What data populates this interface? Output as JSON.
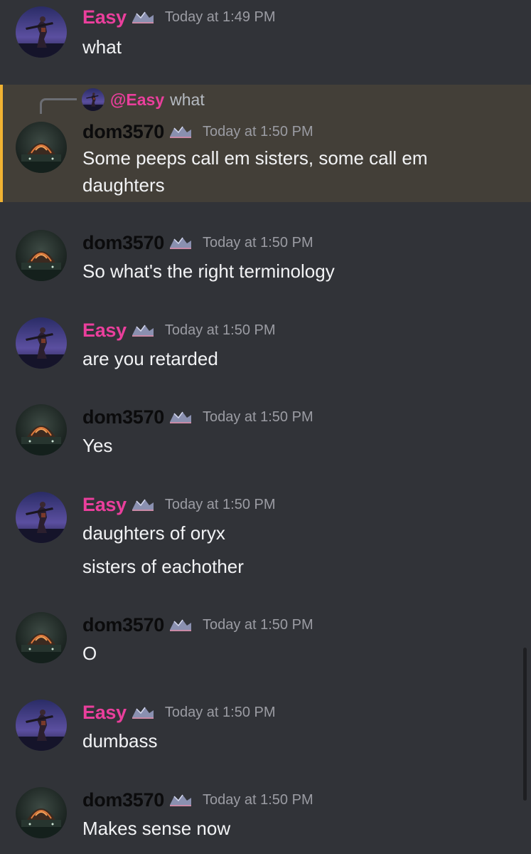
{
  "reply_preview": {
    "mention": "@Easy",
    "text": "what"
  },
  "messages": [
    {
      "user": "Easy",
      "time": "Today at 1:49 PM",
      "lines": [
        "what"
      ]
    },
    {
      "user": "dom3570",
      "time": "Today at 1:50 PM",
      "lines": [
        "Some peeps call em sisters, some call em",
        "daughters"
      ]
    },
    {
      "user": "dom3570",
      "time": "Today at 1:50 PM",
      "lines": [
        "So what's the right terminology"
      ]
    },
    {
      "user": "Easy",
      "time": "Today at 1:50 PM",
      "lines": [
        "are you retarded"
      ]
    },
    {
      "user": "dom3570",
      "time": "Today at 1:50 PM",
      "lines": [
        "Yes"
      ]
    },
    {
      "user": "Easy",
      "time": "Today at 1:50 PM",
      "lines": [
        "daughters of oryx",
        "sisters of eachother"
      ]
    },
    {
      "user": "dom3570",
      "time": "Today at 1:50 PM",
      "lines": [
        "O"
      ]
    },
    {
      "user": "Easy",
      "time": "Today at 1:50 PM",
      "lines": [
        "dumbass"
      ]
    },
    {
      "user": "dom3570",
      "time": "Today at 1:50 PM",
      "lines": [
        "Makes sense now"
      ]
    }
  ],
  "colors": {
    "background": "#313338",
    "reply_highlight": "#433f38",
    "highlight_bar": "#f0b232",
    "easy_name": "#ea3f9c",
    "dom_name": "#0b0b0c",
    "timestamp": "#9b9ca3"
  },
  "icons": {
    "badge": "server-tag-badge-icon",
    "avatar_easy": "sniper-silhouette-avatar",
    "avatar_dom": "glowing-dome-avatar"
  }
}
